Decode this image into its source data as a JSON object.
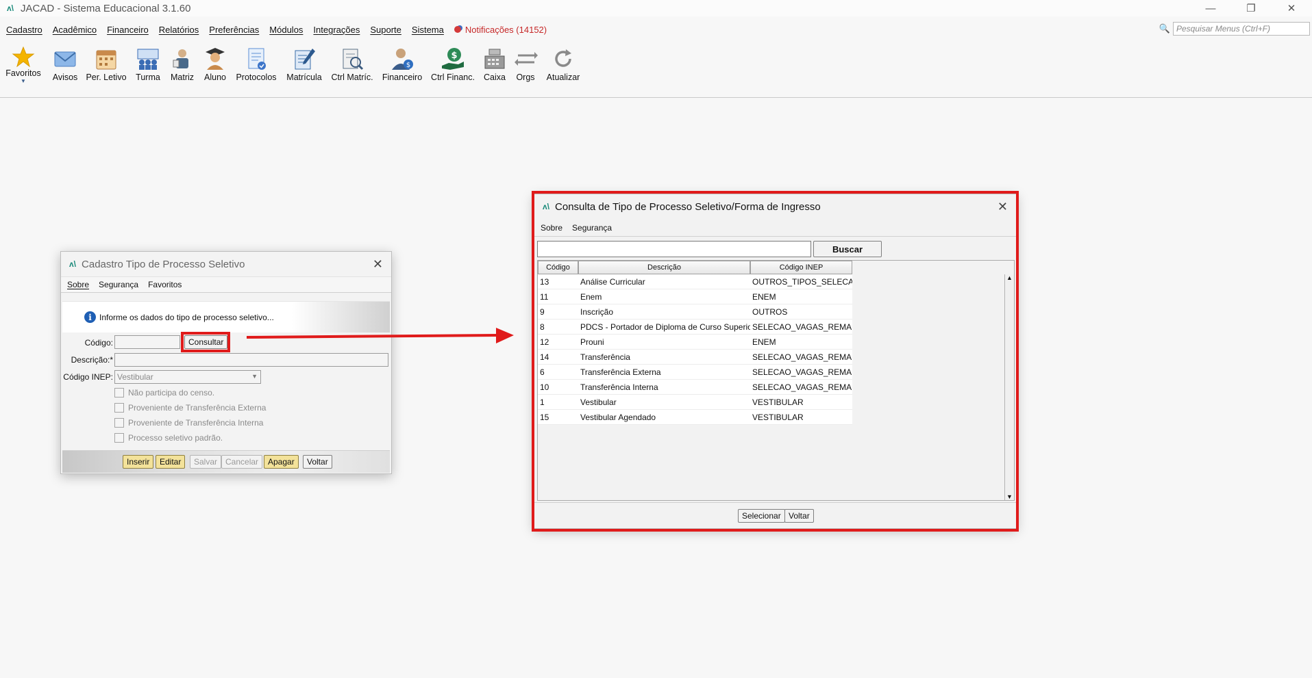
{
  "app": {
    "title": "JACAD - Sistema Educacional 3.1.60",
    "controls": {
      "minimize": "—",
      "restore": "❐",
      "close": "✕"
    }
  },
  "menu": {
    "items": [
      "Cadastro",
      "Acadêmico",
      "Financeiro",
      "Relatórios",
      "Preferências",
      "Módulos",
      "Integrações",
      "Suporte",
      "Sistema"
    ],
    "notifications": "Notificações (14152)",
    "search_placeholder": "Pesquisar Menus (Ctrl+F)"
  },
  "toolbar": {
    "items": [
      {
        "label": "Favoritos",
        "icon": "star-icon",
        "color": "#f4b400"
      },
      {
        "label": "Avisos",
        "icon": "envelope-icon",
        "color": "#5a8fd0"
      },
      {
        "label": "Per. Letivo",
        "icon": "calendar-icon",
        "color": "#c98a4b"
      },
      {
        "label": "Turma",
        "icon": "class-group-icon",
        "color": "#3b6db5"
      },
      {
        "label": "Matriz",
        "icon": "matrix-icon",
        "color": "#4a6a8a"
      },
      {
        "label": "Aluno",
        "icon": "student-icon",
        "color": "#d49a5a"
      },
      {
        "label": "Protocolos",
        "icon": "protocol-doc-icon",
        "color": "#5c8fd6"
      },
      {
        "label": "Matrícula",
        "icon": "enrollment-pen-icon",
        "color": "#3a6ea8"
      },
      {
        "label": "Ctrl Matríc.",
        "icon": "enrollment-search-icon",
        "color": "#5a6f86"
      },
      {
        "label": "Financeiro",
        "icon": "finance-person-icon",
        "color": "#3a5c8a"
      },
      {
        "label": "Ctrl Financ.",
        "icon": "money-hand-icon",
        "color": "#2e8b57"
      },
      {
        "label": "Caixa",
        "icon": "cash-register-icon",
        "color": "#7a7a7a"
      },
      {
        "label": "Orgs",
        "icon": "swap-arrows-icon",
        "color": "#8a8a8a"
      },
      {
        "label": "Atualizar",
        "icon": "refresh-icon",
        "color": "#8a8a8a"
      }
    ]
  },
  "cadastro": {
    "title": "Cadastro Tipo de Processo Seletivo",
    "menu": [
      "Sobre",
      "Segurança",
      "Favoritos"
    ],
    "info": "Informe os dados do tipo de processo seletivo...",
    "labels": {
      "codigo": "Código:",
      "descricao": "Descrição:*",
      "inep": "Código INEP:"
    },
    "consultar": "Consultar",
    "inep_value": "Vestibular",
    "checkboxes": [
      "Não participa do censo.",
      "Proveniente de Transferência Externa",
      "Proveniente de Transferência Interna",
      "Processo seletivo padrão."
    ],
    "buttons": {
      "inserir": "Inserir",
      "editar": "Editar",
      "salvar": "Salvar",
      "cancelar": "Cancelar",
      "apagar": "Apagar",
      "voltar": "Voltar"
    }
  },
  "consulta": {
    "title": "Consulta de Tipo de Processo Seletivo/Forma de Ingresso",
    "menu": [
      "Sobre",
      "Segurança"
    ],
    "buscar": "Buscar",
    "columns": [
      "Código",
      "Descrição",
      "Código INEP"
    ],
    "rows": [
      [
        "13",
        "Análise Curricular",
        "OUTROS_TIPOS_SELECAO"
      ],
      [
        "11",
        "Enem",
        "ENEM"
      ],
      [
        "9",
        "Inscrição",
        "OUTROS"
      ],
      [
        "8",
        "PDCS - Portador de Diploma de Curso Superior",
        "SELECAO_VAGAS_REMAN..."
      ],
      [
        "12",
        "Prouni",
        "ENEM"
      ],
      [
        "14",
        "Transferência",
        "SELECAO_VAGAS_REMAN..."
      ],
      [
        "6",
        "Transferência Externa",
        "SELECAO_VAGAS_REMAN..."
      ],
      [
        "10",
        "Transferência Interna",
        "SELECAO_VAGAS_REMAN..."
      ],
      [
        "1",
        "Vestibular",
        "VESTIBULAR"
      ],
      [
        "15",
        "Vestibular Agendado",
        "VESTIBULAR"
      ]
    ],
    "buttons": {
      "selecionar": "Selecionar",
      "voltar": "Voltar"
    }
  }
}
